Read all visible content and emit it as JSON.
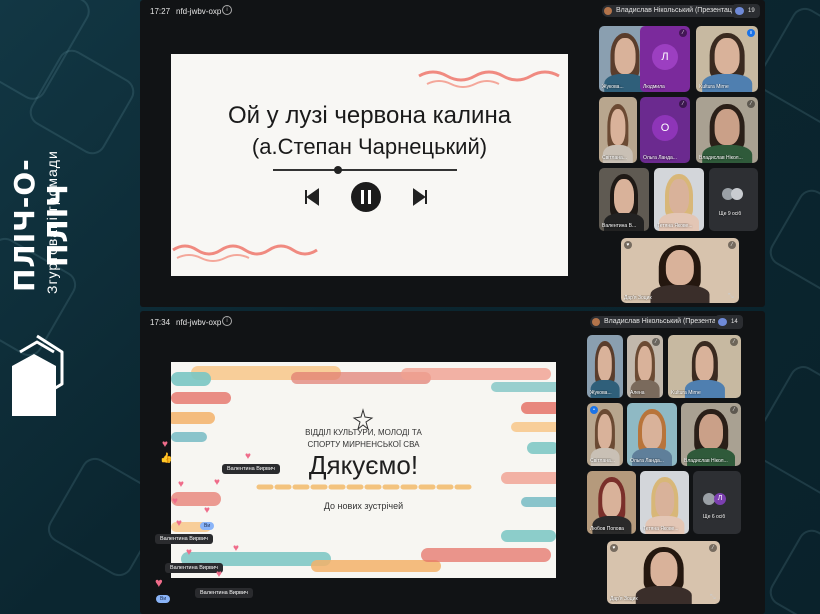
{
  "branding": {
    "title": "ПЛІЧ-О-ПЛІЧ",
    "subtitle": "Згуртовані громади"
  },
  "meeting1": {
    "time": "17:27",
    "code": "nfd-jwbv-oxp",
    "presenter": "Владислав Нікольський (Презентація)",
    "participant_count": "19",
    "slide": {
      "song_title": "Ой у лузі червона калина",
      "song_author": "(а.Степан Чарнецький)"
    },
    "tiles": [
      {
        "name": "Жукова..."
      },
      {
        "name": "Людмила",
        "letter": "Л"
      },
      {
        "name": "Kultura Mirne"
      },
      {
        "name": "Світлана..."
      },
      {
        "name": "Ольга Ланда...",
        "letter": "О"
      },
      {
        "name": "Владислав Нікол..."
      },
      {
        "name": "Валентина В..."
      },
      {
        "name": "Тетяна Якове..."
      },
      {
        "name": "Ще 9 осіб"
      }
    ],
    "featured_name": "Дар'я Зоцик"
  },
  "meeting2": {
    "time": "17:34",
    "code": "nfd-jwbv-oxp",
    "presenter": "Владислав Нікольський (Презентація)",
    "participant_count": "14",
    "slide": {
      "org_line1": "ВІДДІЛ КУЛЬТУРИ, МОЛОДІ ТА",
      "org_line2": "СПОРТУ МИРНЕНСЬКОЇ СВА",
      "thanks": "Дякуємо!",
      "farewell": "До нових зустрічей"
    },
    "tiles": [
      {
        "name": "Жукова..."
      },
      {
        "name": "Алена"
      },
      {
        "name": "Kultura Mirne"
      },
      {
        "name": "Світлана..."
      },
      {
        "name": "Ольга Ланда..."
      },
      {
        "name": "Владислав Нікол..."
      },
      {
        "name": "Любов Попова"
      },
      {
        "name": "Тетяна Якове..."
      },
      {
        "name": "Ще 6 осіб",
        "letter": "Л"
      }
    ],
    "featured_name": "Дар'я Зоцик",
    "reaction_names": [
      "Валентина Вирвич",
      "Валентина Вирвич",
      "Валентина Вирвич",
      "Валентина Вирвич"
    ],
    "chip_label": "Ви"
  },
  "colors": {
    "bg": "#0d2a33",
    "meet_bg": "#111315",
    "accent_pink": "#ef6c8a"
  }
}
